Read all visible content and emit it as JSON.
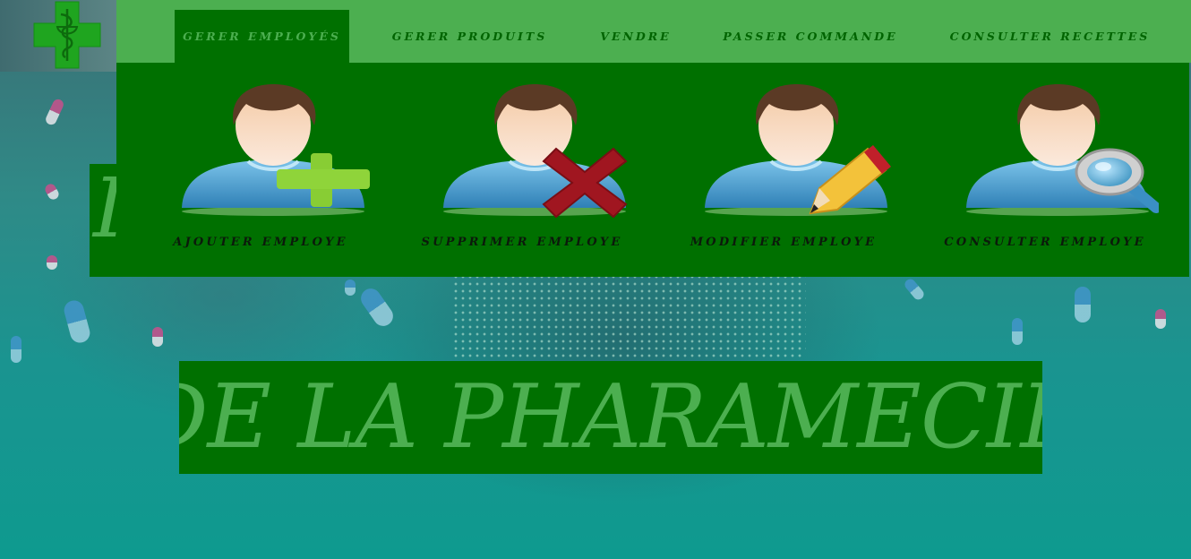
{
  "nav": {
    "items": [
      {
        "label": "GERER EMPLOYÉS",
        "active": true
      },
      {
        "label": "GERER PRODUITS",
        "active": false
      },
      {
        "label": "VENDRE",
        "active": false
      },
      {
        "label": "PASSER COMMANDE",
        "active": false
      },
      {
        "label": "CONSULTER RECETTES",
        "active": false
      }
    ]
  },
  "dropdown": {
    "items": [
      {
        "label": "AJOUTER EMPLOYE",
        "icon": "add-user-icon"
      },
      {
        "label": "SUPPRIMER EMPLOYE",
        "icon": "delete-user-icon"
      },
      {
        "label": "MODIFIER EMPLOYE",
        "icon": "edit-user-icon"
      },
      {
        "label": "CONSULTER EMPLOYE",
        "icon": "search-user-icon"
      }
    ]
  },
  "hero": {
    "hidden_title": "I",
    "banner_text": "DE LA PHARAMECIE"
  },
  "logo": {
    "icon": "pharmacy-cross-icon"
  },
  "colors": {
    "nav_bg": "#4caf50",
    "dark_green": "#007000",
    "text_dark_green": "#006400"
  }
}
